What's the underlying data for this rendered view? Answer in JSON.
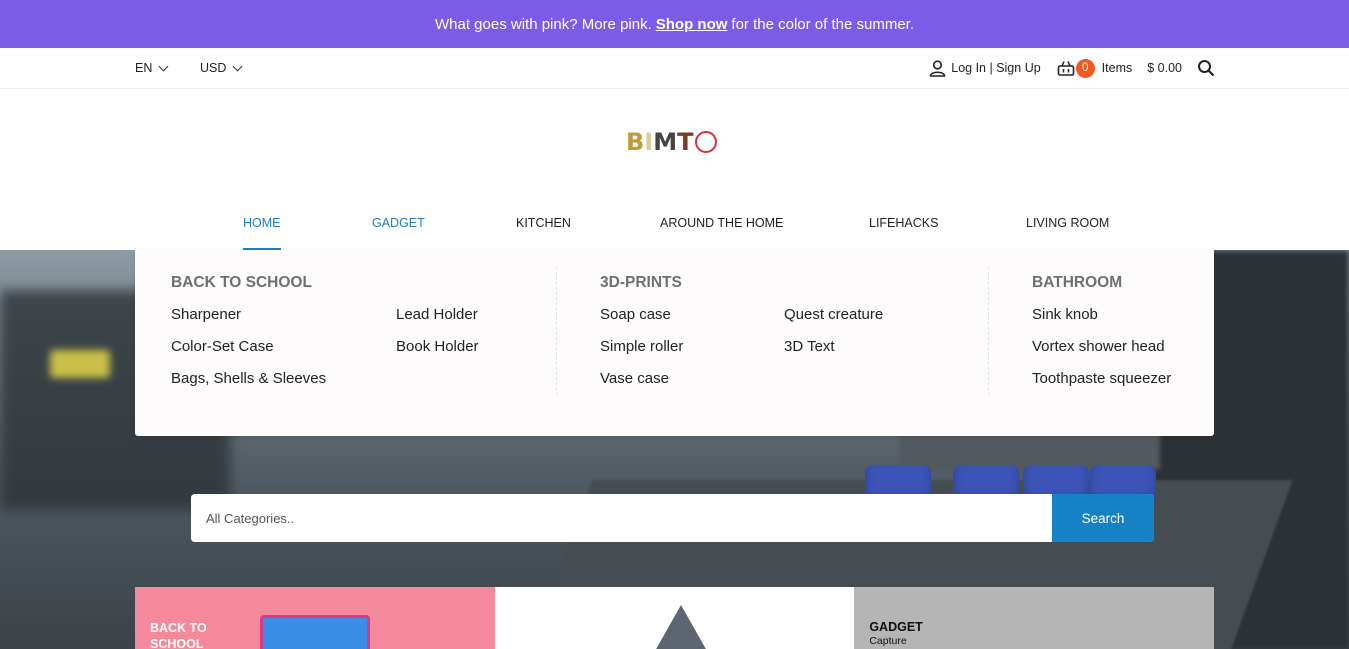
{
  "announcement": {
    "before": "What goes with pink? More pink.",
    "link": "Shop now",
    "after": "for the color of the summer."
  },
  "topbar": {
    "language": "EN",
    "currency": "USD",
    "login": "Log In | Sign Up",
    "cart_count": "0",
    "items_label": "Items",
    "total": "$  0.00",
    "icons": [
      "user-icon",
      "basket-icon",
      "search-icon",
      "chevron-down-icon"
    ]
  },
  "logo": {
    "letters": [
      "B",
      "I",
      "M",
      "T",
      "O"
    ]
  },
  "nav": {
    "items": [
      "HOME",
      "GADGET",
      "KITCHEN",
      "AROUND THE HOME",
      "LIFEHACKS",
      "LIVING ROOM"
    ],
    "active": "HOME",
    "accent": "#1e7fc6"
  },
  "mega_menu": {
    "columns": [
      {
        "title": "BACK TO SCHOOL",
        "links": [
          "Sharpener",
          "Color-Set Case",
          "Bags, Shells & Sleeves",
          "Lead Holder",
          "Book Holder"
        ]
      },
      {
        "title": "3D-PRINTS",
        "links": [
          "Soap case",
          "Simple roller",
          "Vase case",
          "Quest creature",
          "3D Text"
        ]
      },
      {
        "title": "BATHROOM",
        "links": [
          "Sink knob",
          "Vortex shower head",
          "Toothpaste squeezer"
        ]
      }
    ]
  },
  "search": {
    "placeholder": "All Categories..",
    "button": "Search",
    "button_color": "#1582c6"
  },
  "cards": [
    {
      "title_line1": "BACK TO",
      "title_line2": "SCHOOL",
      "subtitle": "",
      "color": "#f4899b"
    },
    {
      "title_line1": "",
      "title_line2": "",
      "subtitle": "",
      "color": "#ffffff"
    },
    {
      "title_line1": "GADGET",
      "title_line2": "",
      "subtitle": "Capture",
      "color": "#b5b5b5"
    }
  ],
  "colors": {
    "announcement_bg": "#7b5ce6",
    "badge": "#f05a22"
  }
}
